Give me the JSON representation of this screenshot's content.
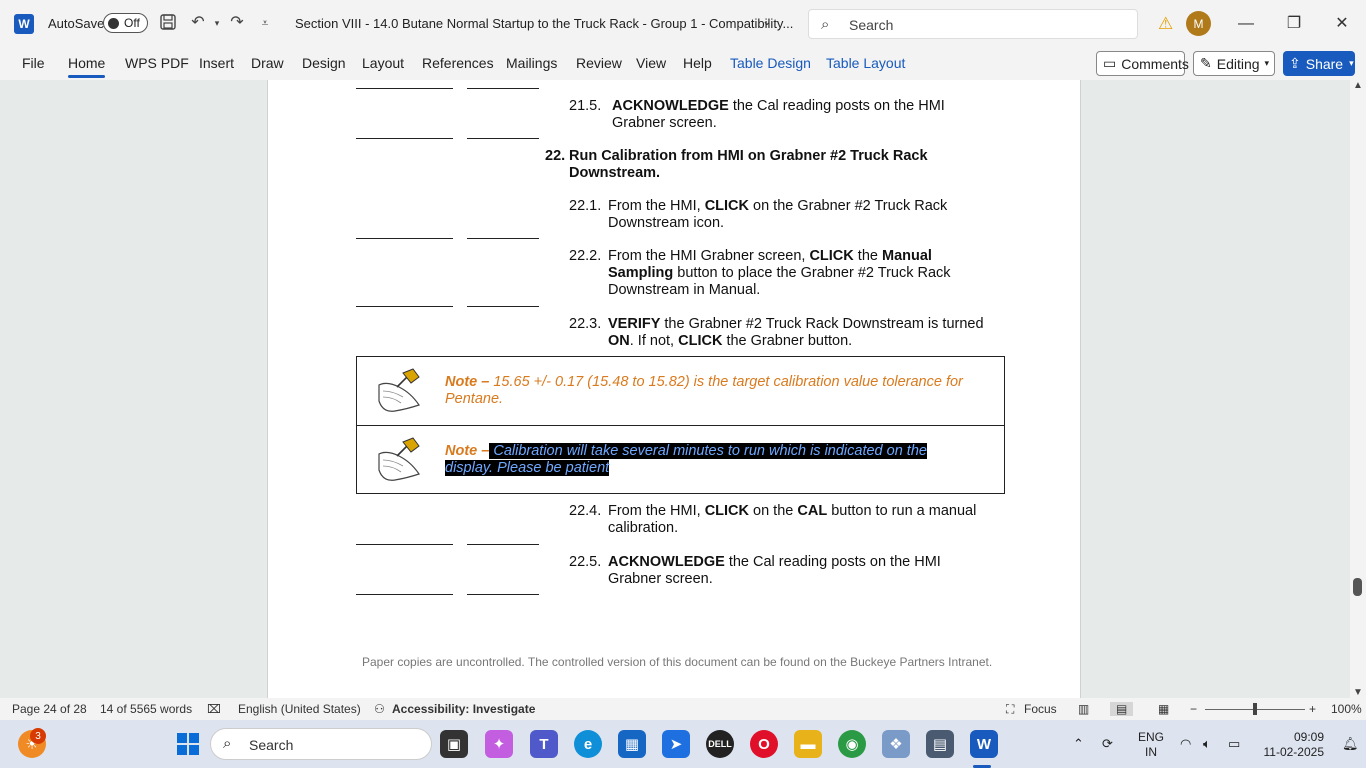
{
  "titlebar": {
    "autosave_label": "AutoSave",
    "autosave_state": "Off",
    "doc_title": "Section VIII - 14.0 Butane Normal Startup to the Truck Rack - Group 1  -  Compatibility...",
    "search_placeholder": "Search",
    "avatar_initial": "M"
  },
  "ribbon": {
    "tabs": [
      "File",
      "Home",
      "WPS PDF",
      "Insert",
      "Draw",
      "Design",
      "Layout",
      "References",
      "Mailings",
      "Review",
      "View",
      "Help",
      "Table Design",
      "Table Layout"
    ],
    "active_tab": "Home",
    "comments_label": "Comments",
    "editing_label": "Editing",
    "share_label": "Share"
  },
  "document": {
    "step_21_5": {
      "num": "21.5.",
      "bold": "ACKNOWLEDGE",
      "text": " the Cal reading posts on the HMI Grabner screen."
    },
    "step_22": {
      "num": "22.",
      "text": "Run Calibration from HMI on Grabner #2 Truck Rack Downstream."
    },
    "step_22_1": {
      "num": "22.1.",
      "pre": "From the HMI, ",
      "bold": "CLICK",
      "post": " on the Grabner #2 Truck Rack Downstream icon."
    },
    "step_22_2": {
      "num": "22.2.",
      "pre": "From the HMI Grabner screen, ",
      "bold1": "CLICK",
      "mid": " the ",
      "bold2": "Manual Sampling",
      "post": " button to place the Grabner #2 Truck Rack Downstream in Manual."
    },
    "step_22_3": {
      "num": "22.3.",
      "bold1": "VERIFY",
      "mid": " the Grabner #2 Truck Rack Downstream is turned ",
      "bold2": "ON",
      "mid2": ". If not, ",
      "bold3": "CLICK",
      "post": " the Grabner button."
    },
    "note1": {
      "lead": "Note –",
      "text": " 15.65 +/- 0.17 (15.48 to 15.82) is the target calibration value tolerance for Pentane."
    },
    "note2": {
      "lead": "Note –",
      "highlighted": " Calibration will take several minutes to run which is indicated on the display. Please be patient"
    },
    "step_22_4": {
      "num": "22.4.",
      "pre": "From the HMI, ",
      "bold1": "CLICK",
      "mid": " on the ",
      "bold2": "CAL",
      "post": " button to run a manual calibration."
    },
    "step_22_5": {
      "num": "22.5.",
      "bold": "ACKNOWLEDGE",
      "text": " the Cal reading posts on the HMI Grabner screen."
    },
    "footer": "Paper copies are uncontrolled. The controlled version of this document can be found on the Buckeye Partners Intranet."
  },
  "statusbar": {
    "page": "Page 24 of 28",
    "words": "14 of 5565 words",
    "language": "English (United States)",
    "accessibility": "Accessibility: Investigate",
    "focus": "Focus",
    "zoom": "100%",
    "zoom_level_percent": 100
  },
  "taskbar": {
    "search_placeholder": "Search",
    "notification_count": "3",
    "lang_line1": "ENG",
    "lang_line2": "IN",
    "time": "09:09",
    "date": "11-02-2025"
  },
  "colors": {
    "accent": "#185abd",
    "note_orange": "#d97a1e",
    "highlight_text": "#6fa8ff"
  }
}
